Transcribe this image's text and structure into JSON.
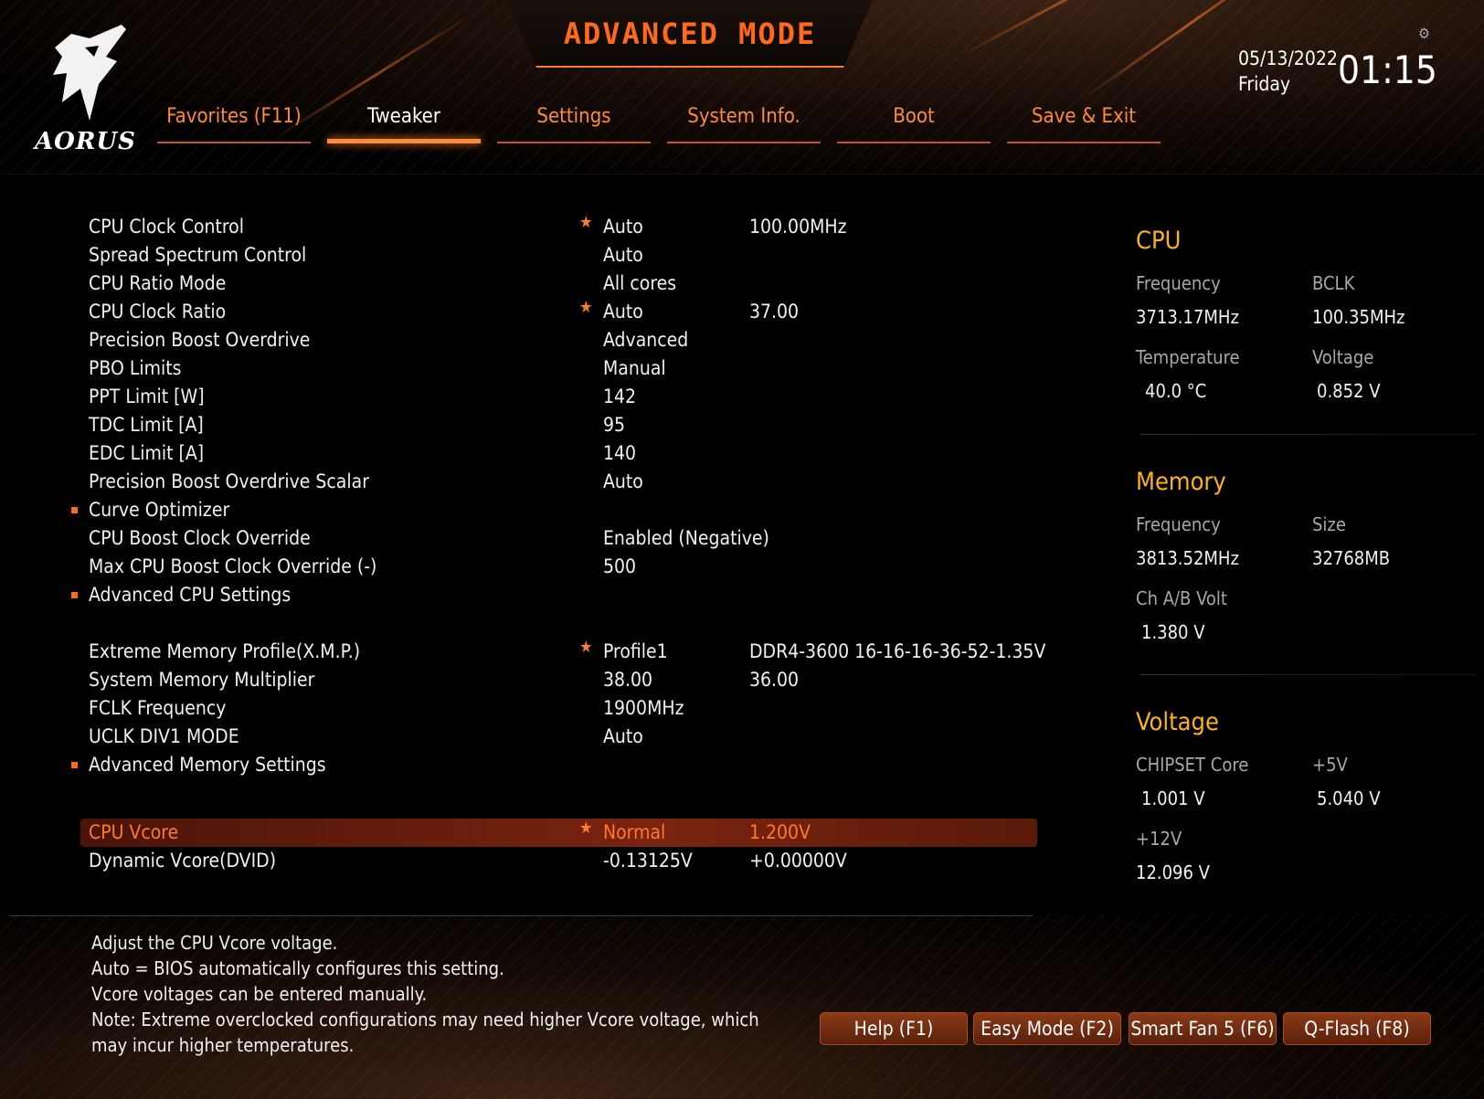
{
  "header": {
    "title": "ADVANCED MODE",
    "logo_text": "AORUS",
    "date": "05/13/2022",
    "day": "Friday",
    "time": "01:15"
  },
  "tabs": [
    {
      "label": "Favorites (F11)"
    },
    {
      "label": "Tweaker"
    },
    {
      "label": "Settings"
    },
    {
      "label": "System Info."
    },
    {
      "label": "Boot"
    },
    {
      "label": "Save & Exit"
    }
  ],
  "active_tab": "Tweaker",
  "settings": [
    {
      "label": "CPU Clock Control",
      "value": "Auto",
      "value2": "100.00MHz",
      "star": true
    },
    {
      "label": "Spread Spectrum Control",
      "value": "Auto"
    },
    {
      "label": "CPU Ratio Mode",
      "value": "All cores"
    },
    {
      "label": "CPU Clock Ratio",
      "value": "Auto",
      "value2": "37.00",
      "star": true
    },
    {
      "label": "Precision Boost Overdrive",
      "value": "Advanced"
    },
    {
      "label": "PBO Limits",
      "value": "Manual"
    },
    {
      "label": "PPT Limit [W]",
      "value": "142"
    },
    {
      "label": "TDC Limit [A]",
      "value": "95"
    },
    {
      "label": "EDC Limit [A]",
      "value": "140"
    },
    {
      "label": "Precision Boost Overdrive Scalar",
      "value": "Auto"
    },
    {
      "label": "Curve Optimizer",
      "submenu": true
    },
    {
      "label": "CPU Boost Clock Override",
      "value": "Enabled (Negative)"
    },
    {
      "label": "Max CPU Boost Clock Override (-)",
      "value": "500"
    },
    {
      "label": "Advanced CPU Settings",
      "submenu": true
    },
    {
      "label": "Extreme Memory Profile(X.M.P.)",
      "value": "Profile1",
      "value2": "DDR4-3600 16-16-16-36-52-1.35V",
      "star": true
    },
    {
      "label": "System Memory Multiplier",
      "value": "38.00",
      "value2": "36.00"
    },
    {
      "label": "FCLK Frequency",
      "value": "1900MHz"
    },
    {
      "label": "UCLK DIV1 MODE",
      "value": "Auto"
    },
    {
      "label": "Advanced Memory Settings",
      "submenu": true
    },
    {
      "label": "CPU Vcore",
      "value": "Normal",
      "value2": "1.200V",
      "star": true,
      "selected": true
    },
    {
      "label": "Dynamic Vcore(DVID)",
      "value": "-0.13125V",
      "value2": "+0.00000V"
    }
  ],
  "help_text": [
    "Adjust the CPU Vcore voltage.",
    "Auto = BIOS automatically configures this setting.",
    "Vcore voltages can be entered manually.",
    "Note: Extreme overclocked configurations may need higher Vcore voltage, which",
    "may incur higher temperatures."
  ],
  "bottom_buttons": [
    {
      "label": "Help (F1)"
    },
    {
      "label": "Easy Mode (F2)"
    },
    {
      "label": "Smart Fan 5 (F6)"
    },
    {
      "label": "Q-Flash (F8)"
    }
  ],
  "sidebar": {
    "cpu": {
      "title": "CPU",
      "frequency_label": "Frequency",
      "frequency": "3713.17MHz",
      "bclk_label": "BCLK",
      "bclk": "100.35MHz",
      "temperature_label": "Temperature",
      "temperature": "40.0 °C",
      "voltage_label": "Voltage",
      "voltage": "0.852 V"
    },
    "memory": {
      "title": "Memory",
      "frequency_label": "Frequency",
      "frequency": "3813.52MHz",
      "size_label": "Size",
      "size": "32768MB",
      "chab_label": "Ch A/B Volt",
      "chab": "1.380 V"
    },
    "voltage": {
      "title": "Voltage",
      "chipset_label": "CHIPSET Core",
      "chipset": "1.001 V",
      "v5_label": "+5V",
      "v5": "5.040 V",
      "v12_label": "+12V",
      "v12": "12.096 V"
    }
  },
  "colors": {
    "accent": "#ff7a2a",
    "section_title": "#ffb21a",
    "selected_row": "#7a2410"
  },
  "icons": [
    "aorus-eagle-logo",
    "gear-icon",
    "star-icon",
    "submenu-bullet-icon"
  ]
}
